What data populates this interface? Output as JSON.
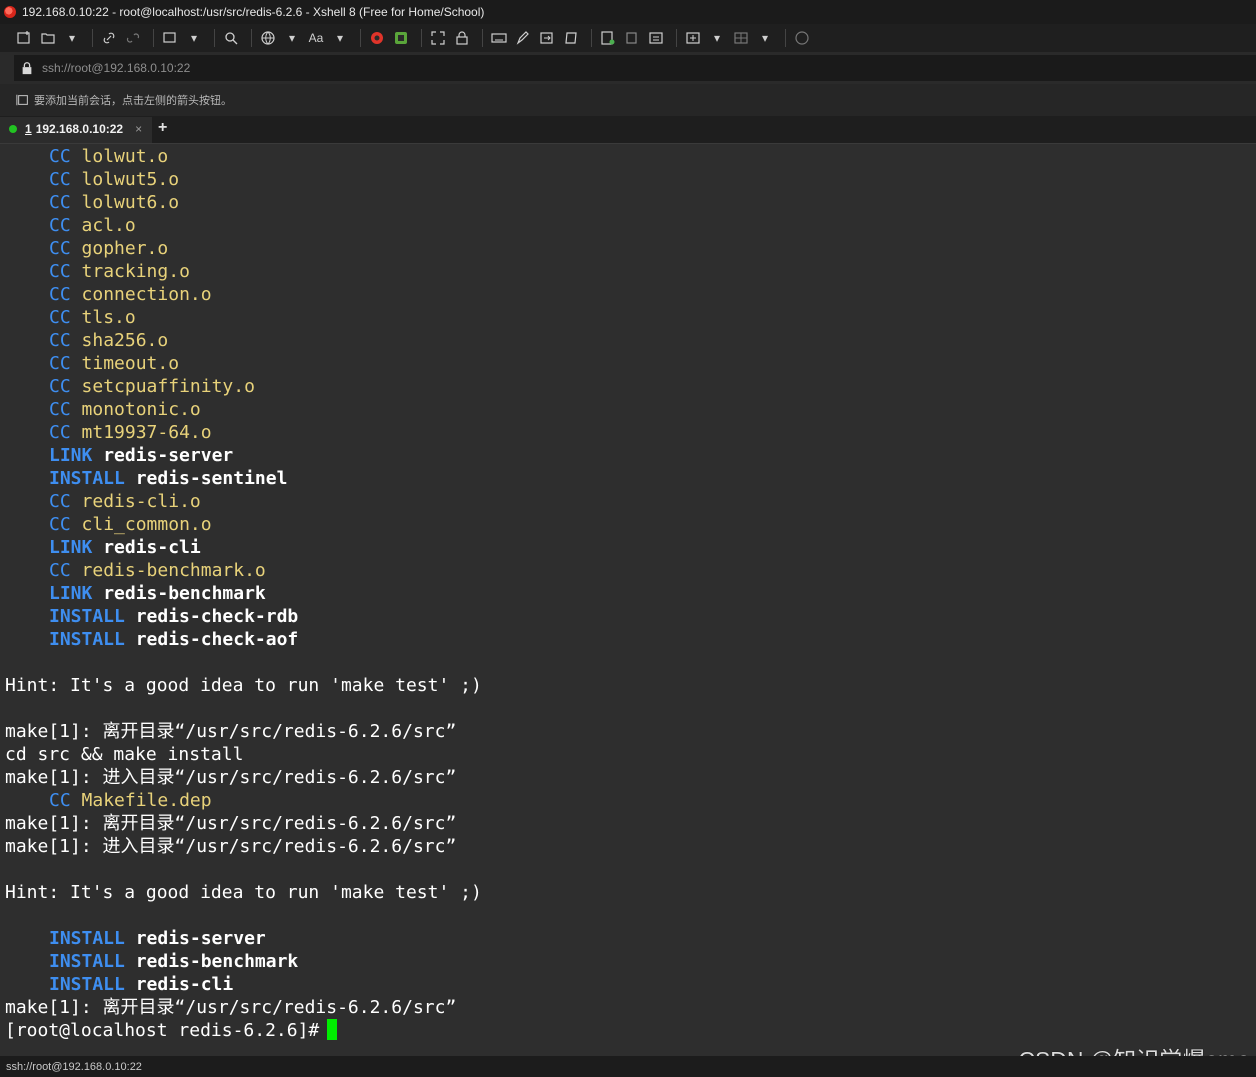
{
  "window": {
    "title": "192.168.0.10:22 - root@localhost:/usr/src/redis-6.2.6 - Xshell 8 (Free for Home/School)"
  },
  "toolbar": {
    "font_label": "Aa"
  },
  "address": {
    "url": "ssh://root@192.168.0.10:22"
  },
  "notice": {
    "text": "要添加当前会话，点击左侧的箭头按钮。"
  },
  "tabs": [
    {
      "number": "1",
      "label": "192.168.0.10:22",
      "close": "×"
    }
  ],
  "new_tab": "+",
  "terminal": {
    "lines": [
      {
        "k": "CC",
        "f": "lolwut.o"
      },
      {
        "k": "CC",
        "f": "lolwut5.o"
      },
      {
        "k": "CC",
        "f": "lolwut6.o"
      },
      {
        "k": "CC",
        "f": "acl.o"
      },
      {
        "k": "CC",
        "f": "gopher.o"
      },
      {
        "k": "CC",
        "f": "tracking.o"
      },
      {
        "k": "CC",
        "f": "connection.o"
      },
      {
        "k": "CC",
        "f": "tls.o"
      },
      {
        "k": "CC",
        "f": "sha256.o"
      },
      {
        "k": "CC",
        "f": "timeout.o"
      },
      {
        "k": "CC",
        "f": "setcpuaffinity.o"
      },
      {
        "k": "CC",
        "f": "monotonic.o"
      },
      {
        "k": "CC",
        "f": "mt19937-64.o"
      },
      {
        "k": "LINK",
        "f": "redis-server"
      },
      {
        "k": "INSTALL",
        "f": "redis-sentinel"
      },
      {
        "k": "CC",
        "f": "redis-cli.o"
      },
      {
        "k": "CC",
        "f": "cli_common.o"
      },
      {
        "k": "LINK",
        "f": "redis-cli"
      },
      {
        "k": "CC",
        "f": "redis-benchmark.o"
      },
      {
        "k": "LINK",
        "f": "redis-benchmark"
      },
      {
        "k": "INSTALL",
        "f": "redis-check-rdb"
      },
      {
        "k": "INSTALL",
        "f": "redis-check-aof"
      },
      {
        "t": ""
      },
      {
        "t": "Hint: It's a good idea to run 'make test' ;)"
      },
      {
        "t": ""
      },
      {
        "t": "make[1]: 离开目录“/usr/src/redis-6.2.6/src”"
      },
      {
        "t": "cd src && make install"
      },
      {
        "t": "make[1]: 进入目录“/usr/src/redis-6.2.6/src”"
      },
      {
        "k": "CC",
        "f": "Makefile.dep"
      },
      {
        "t": "make[1]: 离开目录“/usr/src/redis-6.2.6/src”"
      },
      {
        "t": "make[1]: 进入目录“/usr/src/redis-6.2.6/src”"
      },
      {
        "t": ""
      },
      {
        "t": "Hint: It's a good idea to run 'make test' ;)"
      },
      {
        "t": ""
      },
      {
        "k": "INSTALL",
        "f": "redis-server"
      },
      {
        "k": "INSTALL",
        "f": "redis-benchmark"
      },
      {
        "k": "INSTALL",
        "f": "redis-cli"
      },
      {
        "t": "make[1]: 离开目录“/usr/src/redis-6.2.6/src”"
      }
    ],
    "prompt": "[root@localhost redis-6.2.6]#"
  },
  "watermark": "CSDN @知识学爆omo",
  "status": {
    "text": "ssh://root@192.168.0.10:22"
  }
}
